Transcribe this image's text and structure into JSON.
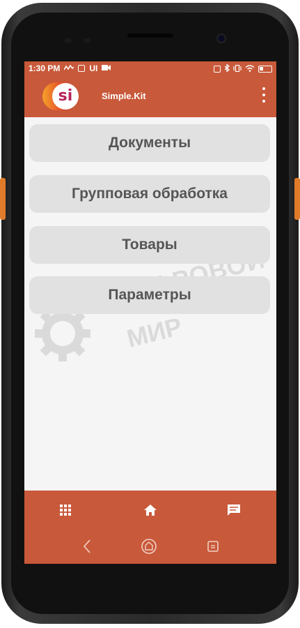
{
  "status_bar": {
    "time": "1:30 PM",
    "ui_label": "UI",
    "icons_left": [
      "signal-squiggle-icon",
      "image-icon",
      "video-icon"
    ],
    "icons_right": [
      "nfc-icon",
      "bluetooth-icon",
      "vibrate-icon",
      "wifi-icon",
      "battery-icon"
    ]
  },
  "app_bar": {
    "logo_text": "si",
    "title": "Simple.Kit",
    "menu_icon": "kebab-menu-icon"
  },
  "menu": {
    "items": [
      {
        "label": "Документы"
      },
      {
        "label": "Групповая обработка"
      },
      {
        "label": "Товары"
      },
      {
        "label": "Параметры"
      }
    ]
  },
  "watermark": {
    "line1": "ЦИФРОВОЙ",
    "line2": "МИР"
  },
  "bottom_nav": {
    "items": [
      "grid-icon",
      "home-icon",
      "chat-icon"
    ]
  },
  "system_nav": {
    "items": [
      "back-icon",
      "home-circle-icon",
      "recents-icon"
    ]
  },
  "colors": {
    "accent": "#c8593a",
    "button_bg": "#e1e1e1",
    "button_text": "#555555",
    "screen_bg": "#f5f5f5",
    "device_side_buttons": "#e07b2a"
  }
}
